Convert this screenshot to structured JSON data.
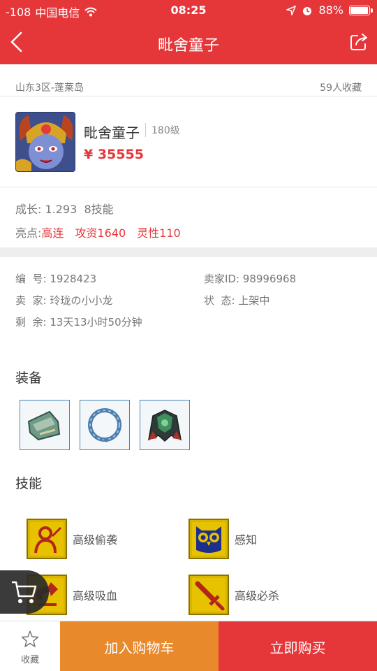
{
  "status_bar": {
    "signal": "-108",
    "carrier": "中国电信",
    "time": "08:25",
    "battery": "88%",
    "battery_level": 0.88
  },
  "nav": {
    "title": "毗舍童子"
  },
  "listing": {
    "server": "山东3区-蓬莱岛",
    "favorites": "59人收藏",
    "pet_name": "毗舍童子",
    "level": "180级",
    "price": "¥ 35555"
  },
  "attributes": {
    "growth": "成长: 1.293  8技能",
    "highlight_label": "亮点:",
    "highlights": [
      "高连",
      "攻资1640",
      "灵性110"
    ]
  },
  "info": {
    "id_label": "编  号: 1928423",
    "seller_id": "卖家ID: 98996968",
    "seller": "卖  家: 玲珑の小小龙",
    "status": "状  态: 上架中",
    "remaining": "剩  余: 13天13小时50分钟"
  },
  "equipment": {
    "title": "装备",
    "items": [
      "bracer-icon",
      "ring-icon",
      "armor-icon"
    ]
  },
  "skills": {
    "title": "技能",
    "items": [
      {
        "name": "高级偷袭",
        "icon": "sneak-attack-icon"
      },
      {
        "name": "感知",
        "icon": "owl-icon"
      },
      {
        "name": "高级吸血",
        "icon": "drain-icon"
      },
      {
        "name": "高级必杀",
        "icon": "sword-icon"
      }
    ]
  },
  "bottom": {
    "favorite_label": "收藏",
    "add_to_cart": "加入购物车",
    "buy_now": "立即购买"
  },
  "colors": {
    "brand_red": "#e5373a",
    "cart_orange": "#e8892c"
  }
}
